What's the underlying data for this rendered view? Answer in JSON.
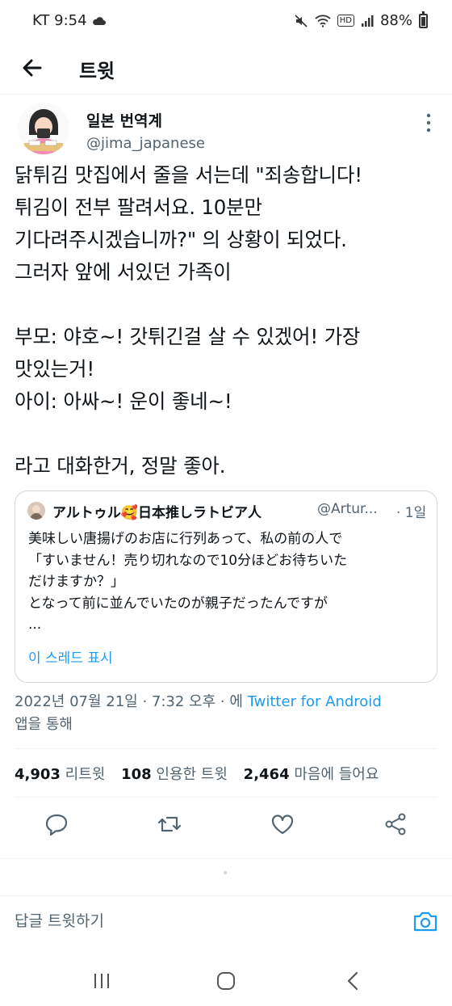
{
  "status_bar": {
    "carrier_time": "KT 9:54",
    "battery": "88%",
    "hd": "HD"
  },
  "header": {
    "title": "트윗"
  },
  "tweet": {
    "author_name": "일본 번역계",
    "author_handle": "@jima_japanese",
    "text": "닭튀김 맛집에서 줄을 서는데 \"죄송합니다!\n튀김이 전부 팔려서요. 10분만\n기다려주시겠습니까?\" 의 상황이 되었다.\n그러자 앞에 서있던 가족이\n\n부모: 야호~! 갓튀긴걸 살 수 있겠어! 가장\n맛있는거!\n아이: 아싸~! 운이 좋네~!\n\n라고 대화한거, 정말 좋아.",
    "quote": {
      "author": "アルトゥル🥰日本推しラトビア人",
      "handle": "@Artur...",
      "time": "· 1일",
      "text": "美味しい唐揚げのお店に行列あって、私の前の人で\n「すいません！売り切れなので10分ほどお待ちいた\nだけますか？」\nとなって前に並んでいたのが親子だったんですが\n...",
      "show_thread": "이 스레드 표시"
    },
    "meta": {
      "datetime": "2022년 07월 21일 · 7:32 오후 · 에 ",
      "source": "Twitter for Android",
      "suffix": "앱을 통해"
    },
    "stats": {
      "retweets_count": "4,903",
      "retweets_label": "리트윗",
      "quotes_count": "108",
      "quotes_label": "인용한 트윗",
      "likes_count": "2,464",
      "likes_label": "마음에 들어요"
    }
  },
  "reply": {
    "placeholder": "답글 트윗하기"
  },
  "icons": {
    "back": "arrow-left-icon",
    "more": "more-vertical-icon",
    "reply": "comment-icon",
    "retweet": "retweet-icon",
    "like": "heart-icon",
    "share": "share-icon",
    "camera": "camera-icon"
  },
  "colors": {
    "accent": "#1d9bf0",
    "secondary_text": "#536471",
    "text": "#0f1419"
  }
}
